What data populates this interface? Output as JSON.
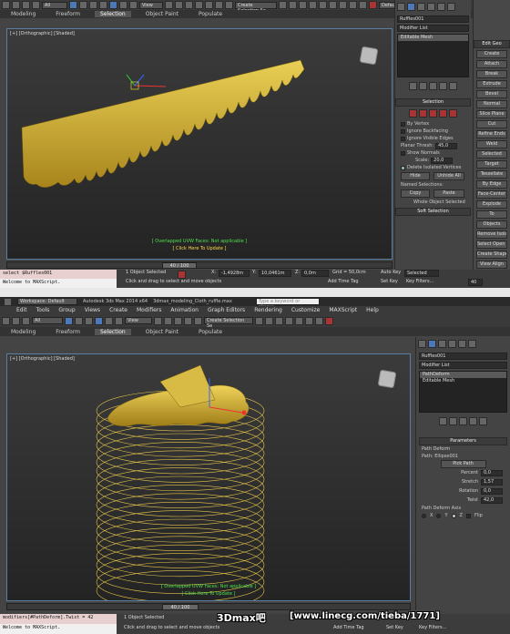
{
  "top": {
    "toolbar": {
      "filter": "All",
      "view_select": "View",
      "named_selection": "Create Selection Se",
      "right_field": "Default"
    },
    "ribbon_tabs": [
      "Modeling",
      "Freeform",
      "Selection",
      "Object Paint",
      "Populate"
    ],
    "viewport": {
      "label": "[+] [Orthographic] [Shaded]",
      "message1": "[ Overlapped UVW Faces: Not applicable ]",
      "message2": "[ Click Here To Update ]"
    },
    "command_panel": {
      "object_name": "Ruffles001",
      "modifier_list": "Modifier List",
      "stack": [
        "Editable Mesh"
      ],
      "rollout": "Selection",
      "checkboxes": [
        "By Vertex",
        "Ignore Backfacing",
        "Ignore Visible Edges"
      ],
      "planar_thresh_label": "Planar Thresh:",
      "planar_thresh_value": "45,0",
      "show_normals": "Show Normals",
      "scale_label": "Scale:",
      "scale_value": "20,0",
      "delete_isolated": "Delete Isolated Vertices",
      "hide_btn": "Hide",
      "unhide_all_btn": "Unhide All",
      "named_selections": "Named Selections:",
      "copy_btn": "Copy",
      "paste_btn": "Paste",
      "whole_object": "Whole Object Selected",
      "soft_selection": "Soft Selection"
    },
    "edit_geometry": {
      "title": "Edit Geo",
      "buttons": [
        "Create",
        "Attach",
        "Break",
        "Extrude",
        "Bevel",
        "Normal",
        "Slice Plane",
        "Cut",
        "Refine Ends",
        "Weld",
        "Selected",
        "Target",
        "Tessellate",
        "By Edge",
        "Face-Center",
        "Explode",
        "To",
        "Objects",
        "Remove Isolated",
        "Select Open Edges",
        "Create Shape from Edges",
        "View Align",
        "Make Planar",
        "Collapse"
      ]
    },
    "timeline": {
      "frame": "40 / 100"
    },
    "script": {
      "line1": "select $Ruffles001",
      "line2": "Welcome to MAXScript."
    },
    "status": {
      "selected": "1 Object Selected",
      "hint": "Click and drag to select and move objects",
      "x_label": "X:",
      "x": "-1,4928m",
      "y_label": "Y:",
      "y": "10,0461m",
      "z_label": "Z:",
      "z": "0,0m",
      "grid": "Grid = 50,0cm",
      "auto_key": "Auto Key",
      "set_key": "Set Key",
      "key_filter_select": "Selected",
      "key_filters": "Key Filters...",
      "add_time_tag": "Add Time Tag",
      "frame_value": "40"
    }
  },
  "bottom": {
    "title_bar": {
      "workspace": "Workspace: Default",
      "app_title": "Autodesk 3ds Max 2014 x64",
      "file": "3dmax_modeling_Cloth_ruffle.max",
      "search": "Type a keyword or phrase"
    },
    "menu": [
      "Edit",
      "Tools",
      "Group",
      "Views",
      "Create",
      "Modifiers",
      "Animation",
      "Graph Editors",
      "Rendering",
      "Customize",
      "MAXScript",
      "Help"
    ],
    "toolbar": {
      "filter": "All",
      "view_select": "View",
      "named_selection": "Create Selection Se"
    },
    "ribbon_tabs": [
      "Modeling",
      "Freeform",
      "Selection",
      "Object Paint",
      "Populate"
    ],
    "viewport": {
      "label": "[+] [Orthographic] [Shaded]",
      "message1": "[ Overlapped UVW Faces: Not applicable ]",
      "message2": "[ Click Here To Update ]"
    },
    "command_panel": {
      "object_name": "Ruffles001",
      "modifier_list": "Modifier List",
      "stack": [
        "PathDeform",
        "Editable Mesh"
      ],
      "rollout": "Parameters",
      "path_deform_label": "Path Deform",
      "path_label": "Path: Ellipse001",
      "pick_path": "Pick Path",
      "percent_label": "Percent",
      "percent": "0,0",
      "stretch_label": "Stretch",
      "stretch": "1,57",
      "rotation_label": "Rotation",
      "rotation": "0,0",
      "twist_label": "Twist",
      "twist": "42,0",
      "axis_label": "Path Deform Axis",
      "axis_x": "X",
      "axis_y": "Y",
      "axis_z": "Z",
      "flip": "Flip"
    },
    "timeline": {
      "frame": "40 / 100"
    },
    "script": {
      "line1": "modifiers[#PathDeform].Twist = 42",
      "line2": "Welcome to MAXScript."
    },
    "status": {
      "selected": "1 Object Selected",
      "hint": "Click and drag to select and move objects",
      "add_time_tag": "Add Time Tag",
      "set_key": "Set Key",
      "key_filters": "Key Filters..."
    },
    "watermark": {
      "brand": "3Dmax吧",
      "url": "[www.linecg.com/tieba/1771]"
    }
  }
}
